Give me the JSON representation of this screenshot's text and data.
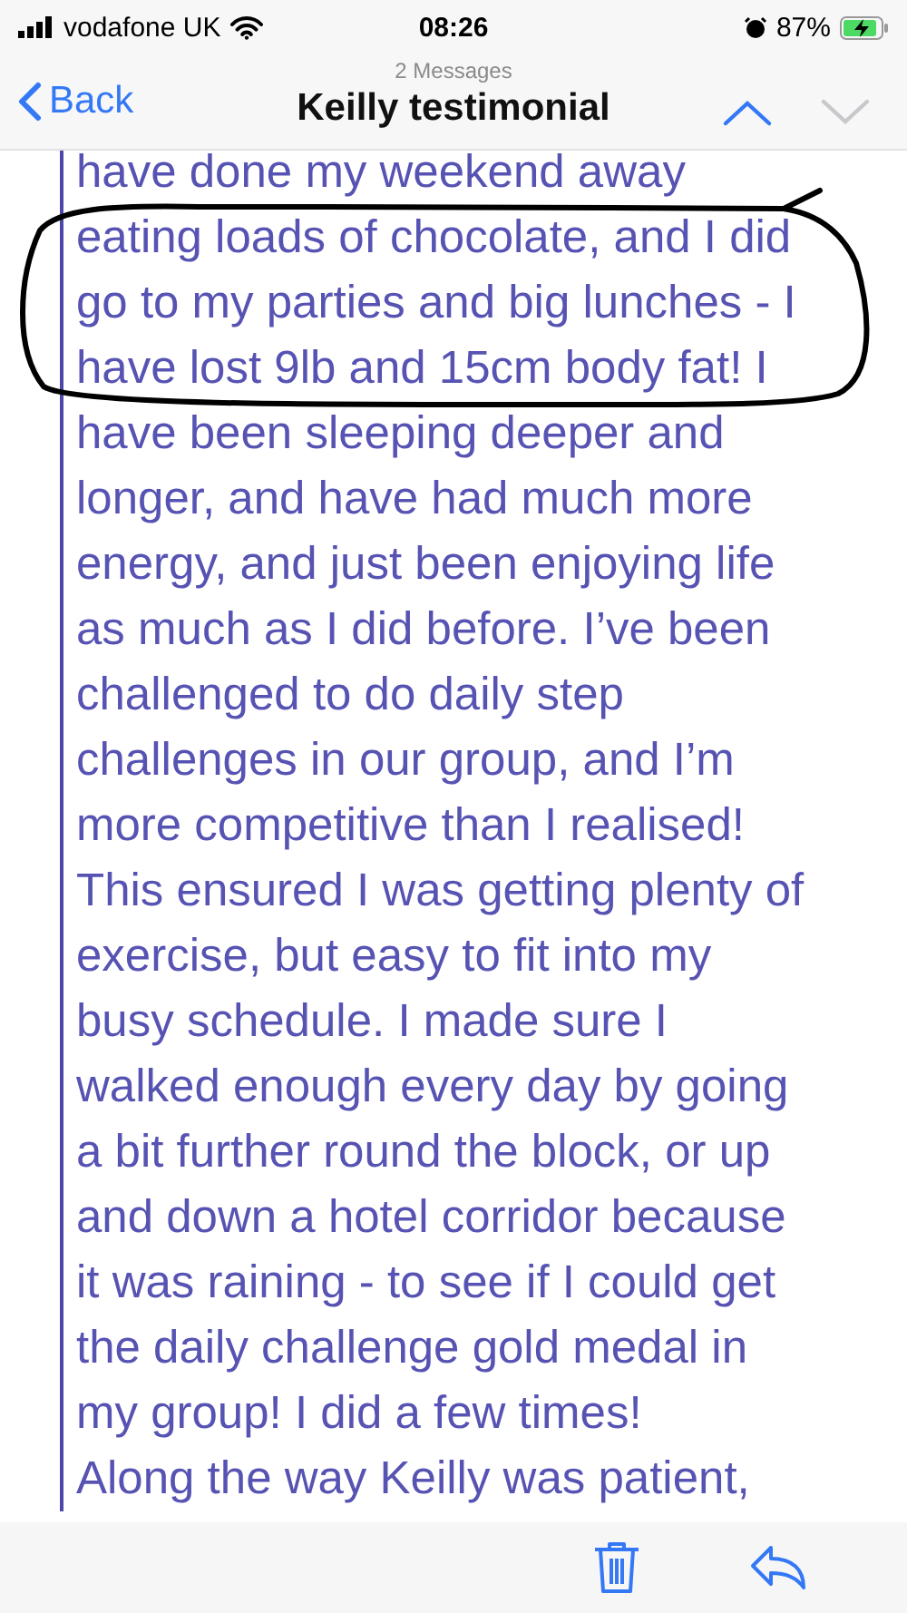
{
  "status_bar": {
    "carrier": "vodafone UK",
    "time": "08:26",
    "battery": "87%"
  },
  "nav": {
    "back": "Back",
    "subtitle": "2 Messages",
    "title": "Keilly testimonial",
    "previous_disabled": false,
    "next_disabled": true
  },
  "message": {
    "lines": [
      "have done my weekend away",
      "eating loads of chocolate, and I did",
      "go to my parties and big lunches - I",
      "have lost 9lb and 15cm body fat! I",
      "have been sleeping deeper and",
      "longer, and have had much more",
      "energy, and just been enjoying life",
      "as much as I did before. I’ve been",
      "challenged to do daily step",
      "challenges in our group, and I’m",
      "more competitive than I realised!",
      "This ensured I was getting plenty of",
      "exercise, but easy to fit into my",
      "busy schedule. I made sure I",
      "walked enough every day by going",
      "a bit further round the block, or up",
      "and down a hotel corridor because",
      "it was raining - to see if I could get",
      "the daily challenge gold medal in",
      "my group! I did a few times!",
      "Along the way Keilly was patient,"
    ]
  }
}
